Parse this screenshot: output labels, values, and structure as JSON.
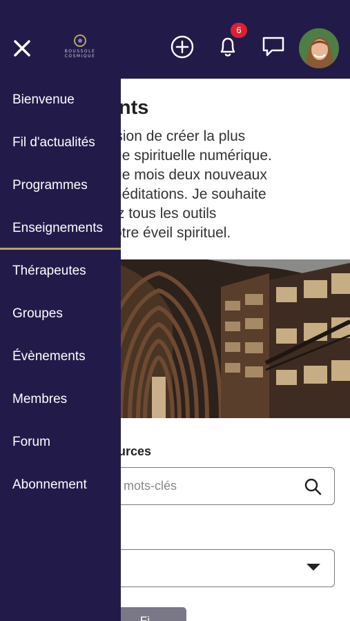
{
  "header": {
    "logo_text": [
      "BOUSSOLE",
      "COSMIQUE"
    ],
    "notification_count": "6",
    "icons": [
      "close-icon",
      "plus-circle-icon",
      "bell-icon",
      "chat-icon",
      "avatar"
    ]
  },
  "drawer": {
    "items": [
      {
        "label": "Bienvenue"
      },
      {
        "label": "Fil d'actualités"
      },
      {
        "label": "Programmes"
      },
      {
        "label": "Enseignements",
        "active": true
      },
      {
        "label": "Thérapeutes"
      },
      {
        "label": "Groupes"
      },
      {
        "label": "Évènements"
      },
      {
        "label": "Membres"
      },
      {
        "label": "Forum"
      },
      {
        "label": "Abonnement"
      }
    ]
  },
  "main": {
    "title": "ments",
    "intro_lines": [
      "la vision de créer la plus",
      "hèque spirituelle numérique.",
      "haque mois deux nouveaux",
      "ırs méditations. Je souhaite",
      "ayez tous les outils",
      "ur votre éveil spirituel."
    ],
    "resources_label": "essources",
    "search_placeholder": "mots-clés",
    "filter_button": "Fi"
  },
  "colors": {
    "brand_dark": "#221b4a",
    "accent_gold": "#b9a36a",
    "badge_red": "#d82233"
  }
}
